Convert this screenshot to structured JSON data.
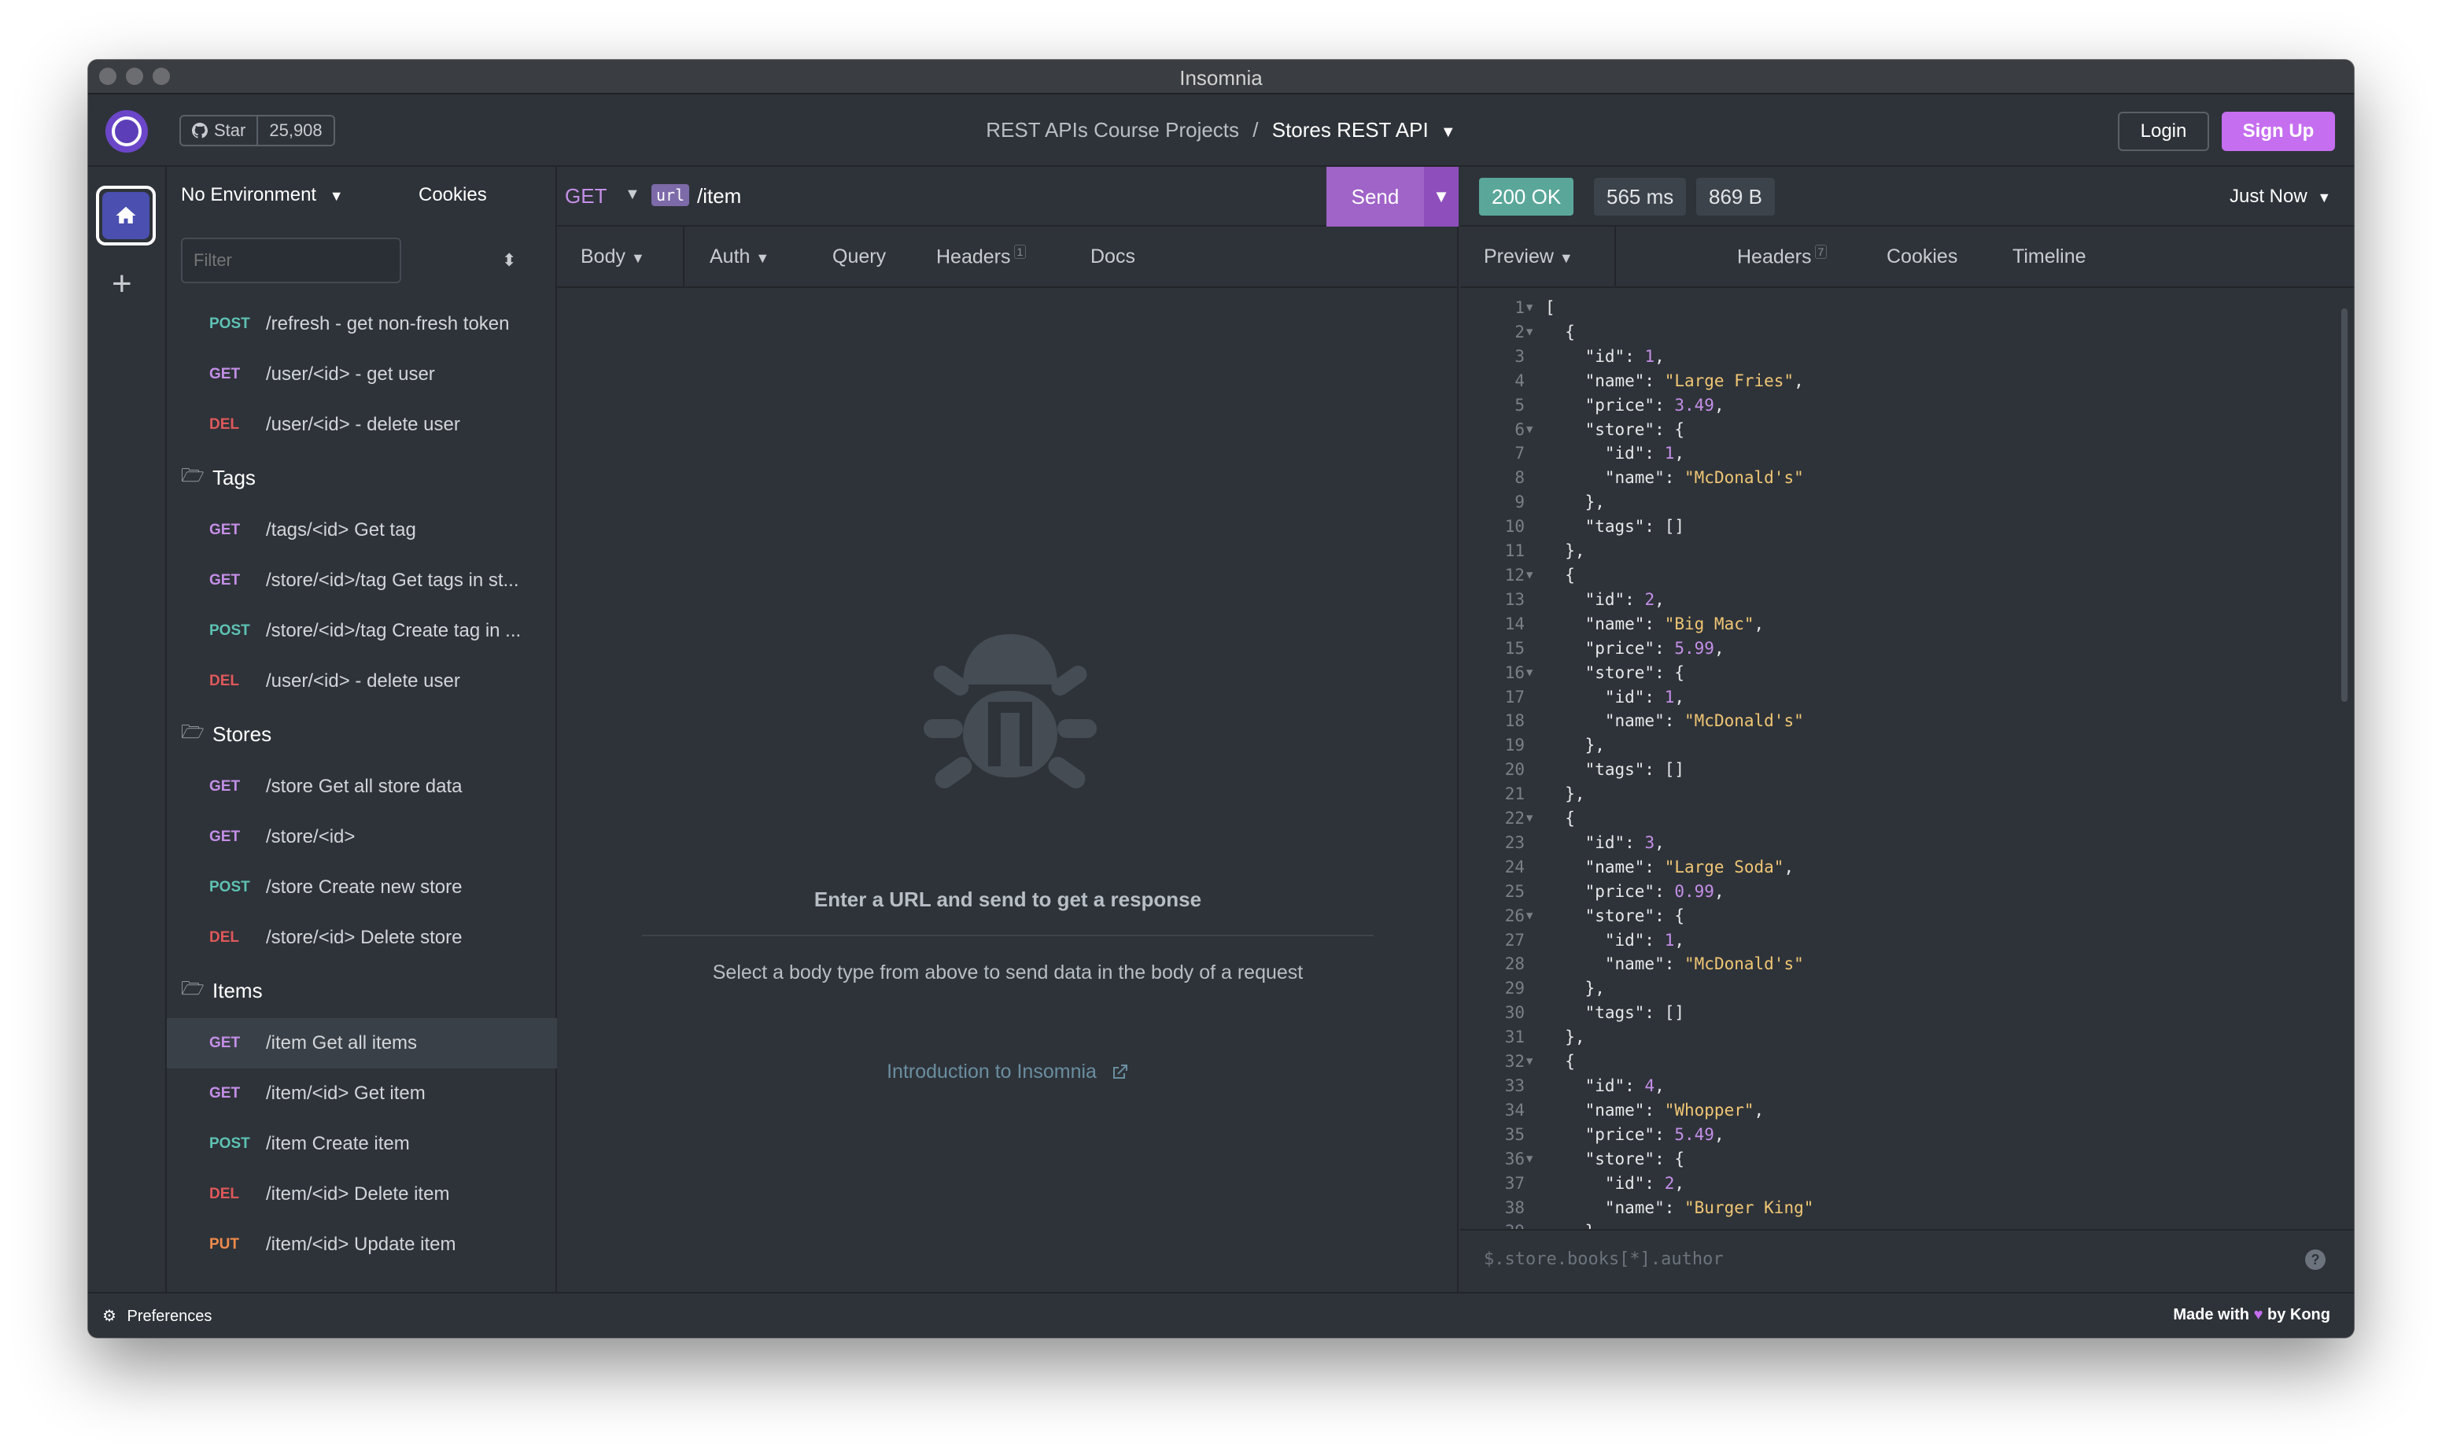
{
  "window": {
    "title": "Insomnia"
  },
  "topbar": {
    "star_label": "Star",
    "star_count": "25,908",
    "breadcrumb_parent": "REST APIs Course Projects",
    "breadcrumb_sep": "/",
    "breadcrumb_current": "Stores REST API",
    "login_label": "Login",
    "signup_label": "Sign Up"
  },
  "sidebar": {
    "environment": "No Environment",
    "cookies_label": "Cookies",
    "filter_placeholder": "Filter",
    "items": [
      {
        "kind": "req",
        "method": "POST",
        "label": "/refresh - get non-fresh token"
      },
      {
        "kind": "req",
        "method": "GET",
        "label": "/user/<id> - get user"
      },
      {
        "kind": "req",
        "method": "DEL",
        "label": "/user/<id> - delete user"
      },
      {
        "kind": "folder",
        "label": "Tags"
      },
      {
        "kind": "req",
        "method": "GET",
        "label": "/tags/<id> Get tag"
      },
      {
        "kind": "req",
        "method": "GET",
        "label": "/store/<id>/tag Get tags in st..."
      },
      {
        "kind": "req",
        "method": "POST",
        "label": "/store/<id>/tag Create tag in ..."
      },
      {
        "kind": "req",
        "method": "DEL",
        "label": "/user/<id> - delete user"
      },
      {
        "kind": "folder",
        "label": "Stores"
      },
      {
        "kind": "req",
        "method": "GET",
        "label": "/store Get all store data"
      },
      {
        "kind": "req",
        "method": "GET",
        "label": "/store/<id>"
      },
      {
        "kind": "req",
        "method": "POST",
        "label": "/store Create new store"
      },
      {
        "kind": "req",
        "method": "DEL",
        "label": "/store/<id> Delete store"
      },
      {
        "kind": "folder",
        "label": "Items"
      },
      {
        "kind": "req",
        "method": "GET",
        "label": "/item Get all items",
        "active": true
      },
      {
        "kind": "req",
        "method": "GET",
        "label": "/item/<id> Get item"
      },
      {
        "kind": "req",
        "method": "POST",
        "label": "/item Create item"
      },
      {
        "kind": "req",
        "method": "DEL",
        "label": "/item/<id> Delete item"
      },
      {
        "kind": "req",
        "method": "PUT",
        "label": "/item/<id> Update item"
      }
    ]
  },
  "request": {
    "method": "GET",
    "url_tag": "url",
    "url_path": "/item",
    "send_label": "Send",
    "tabs": {
      "body": "Body",
      "auth": "Auth",
      "query": "Query",
      "headers": "Headers",
      "headers_count": "1",
      "docs": "Docs"
    },
    "empty_title": "Enter a URL and send to get a response",
    "empty_sub": "Select a body type from above to send data in the body of a request",
    "intro_link": "Introduction to Insomnia"
  },
  "response": {
    "status": "200 OK",
    "time": "565 ms",
    "size": "869 B",
    "when": "Just Now",
    "tabs": {
      "preview": "Preview",
      "headers": "Headers",
      "headers_count": "7",
      "cookies": "Cookies",
      "timeline": "Timeline"
    },
    "jsonpath_placeholder": "$.store.books[*].author",
    "lines": [
      "[",
      "  {",
      "    \"id\": 1,",
      "    \"name\": \"Large Fries\",",
      "    \"price\": 3.49,",
      "    \"store\": {",
      "      \"id\": 1,",
      "      \"name\": \"McDonald's\"",
      "    },",
      "    \"tags\": []",
      "  },",
      "  {",
      "    \"id\": 2,",
      "    \"name\": \"Big Mac\",",
      "    \"price\": 5.99,",
      "    \"store\": {",
      "      \"id\": 1,",
      "      \"name\": \"McDonald's\"",
      "    },",
      "    \"tags\": []",
      "  },",
      "  {",
      "    \"id\": 3,",
      "    \"name\": \"Large Soda\",",
      "    \"price\": 0.99,",
      "    \"store\": {",
      "      \"id\": 1,",
      "      \"name\": \"McDonald's\"",
      "    },",
      "    \"tags\": []",
      "  },",
      "  {",
      "    \"id\": 4,",
      "    \"name\": \"Whopper\",",
      "    \"price\": 5.49,",
      "    \"store\": {",
      "      \"id\": 2,",
      "      \"name\": \"Burger King\"",
      "    },"
    ],
    "fold_lines": [
      1,
      2,
      6,
      12,
      16,
      22,
      26,
      32,
      36
    ]
  },
  "footer": {
    "preferences_label": "Preferences",
    "made_with_prefix": "Made with",
    "made_with_suffix": "by Kong"
  },
  "colors": {
    "accent": "#c56ef0",
    "get": "#c48fe8",
    "post": "#5ec3b4",
    "del": "#e0585a",
    "put": "#f08b4c",
    "status_ok": "#5aa79a"
  },
  "icons": [
    "github-icon",
    "chevron-down-icon",
    "home-icon",
    "plus-icon",
    "sort-icon",
    "add-circle-icon",
    "folder-open-icon",
    "bug-icon",
    "external-link-icon",
    "gear-icon",
    "heart-icon",
    "help-icon"
  ]
}
